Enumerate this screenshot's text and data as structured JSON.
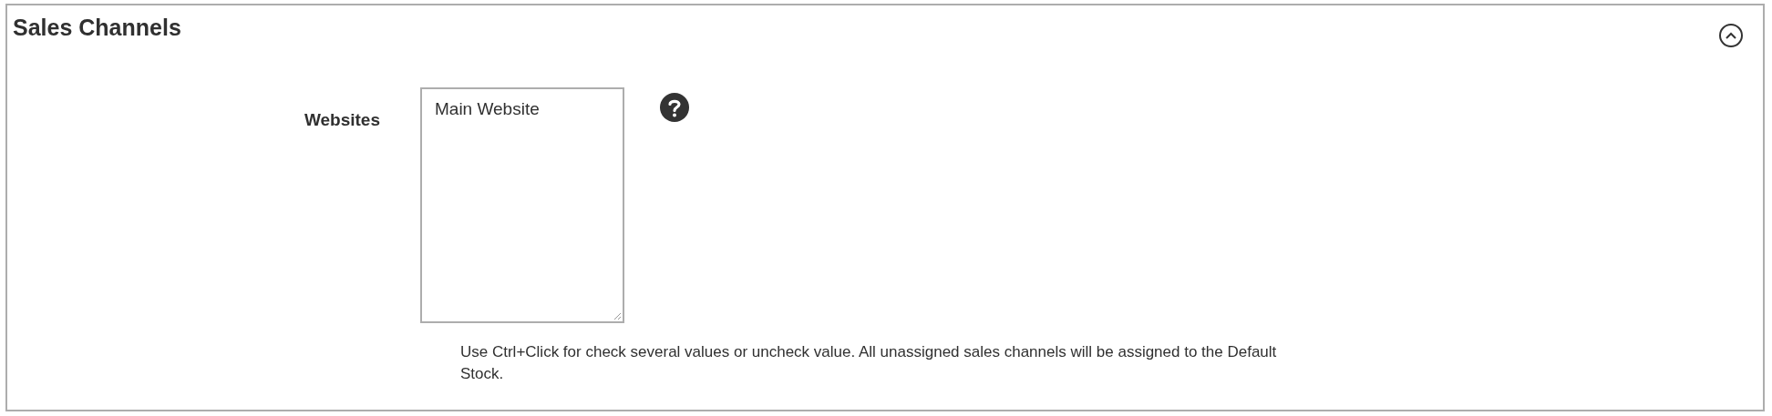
{
  "section": {
    "title": "Sales Channels",
    "expanded": true
  },
  "field": {
    "label": "Websites",
    "options": [
      {
        "label": "Main Website",
        "selected": false
      }
    ],
    "note": "Use Ctrl+Click for check several values or uncheck value. All unassigned sales channels will be assigned to the Default Stock."
  }
}
